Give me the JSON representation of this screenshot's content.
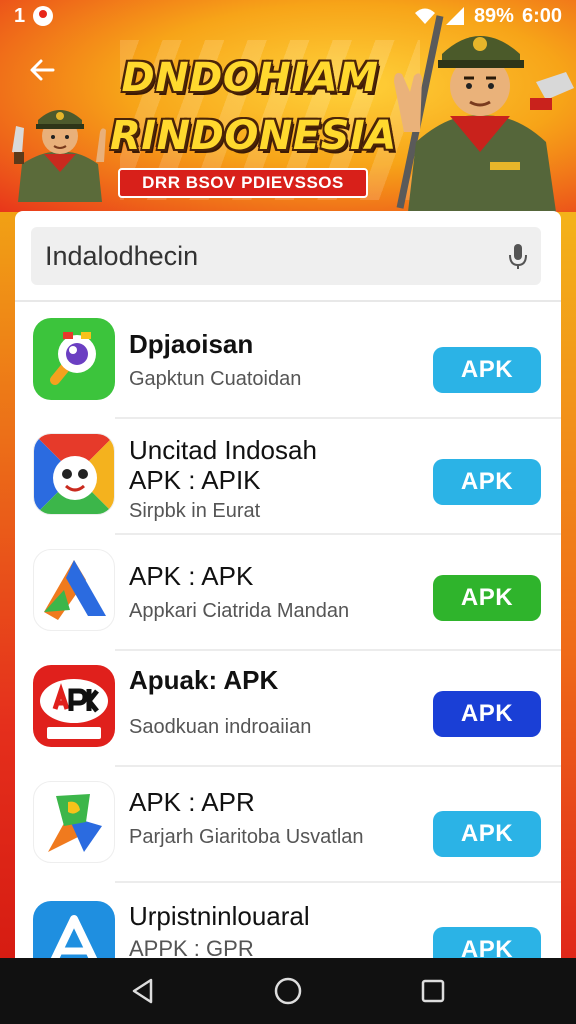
{
  "status_bar": {
    "left_text": "1",
    "battery": "89%",
    "time": "6:00"
  },
  "banner": {
    "title_line1": "DNDOHIAM",
    "title_line2": "RINDONESIA",
    "subtitle": "DRR BSOV PDIEVSSOS"
  },
  "search": {
    "value": "Indalodhecin"
  },
  "apps": [
    {
      "name": "Dpjaoisan",
      "name_line2": "",
      "subtitle": "Gapktun Cuatoidan",
      "button": "APK",
      "button_color": "#2bb3e6",
      "icon": "camera-app-icon"
    },
    {
      "name": "Uncitad Indosah",
      "name_line2": "APK : APIK",
      "subtitle": "Sirpbk in Eurat",
      "button": "APK",
      "button_color": "#2bb3e6",
      "icon": "mascot-app-icon"
    },
    {
      "name": "APK : APK",
      "name_line2": "",
      "subtitle": "Appkari Ciatrida Mandan",
      "button": "APK",
      "button_color": "#2fb42c",
      "icon": "triangle-app-icon"
    },
    {
      "name": "Apuak: APK",
      "name_line2": "",
      "subtitle": "Saodkuan indroaiian",
      "button": "APK",
      "button_color": "#1a3fd6",
      "icon": "apk-logo-app-icon"
    },
    {
      "name": "APK : APR",
      "name_line2": "",
      "subtitle": "Parjarh Giaritoba Usvatlan",
      "button": "APK",
      "button_color": "#2bb3e6",
      "icon": "map-app-icon"
    },
    {
      "name": "Urpistninlouaral",
      "name_line2": "APPK : GPR",
      "subtitle": "",
      "button": "APK",
      "button_color": "#2bb3e6",
      "icon": "store-app-icon"
    }
  ]
}
